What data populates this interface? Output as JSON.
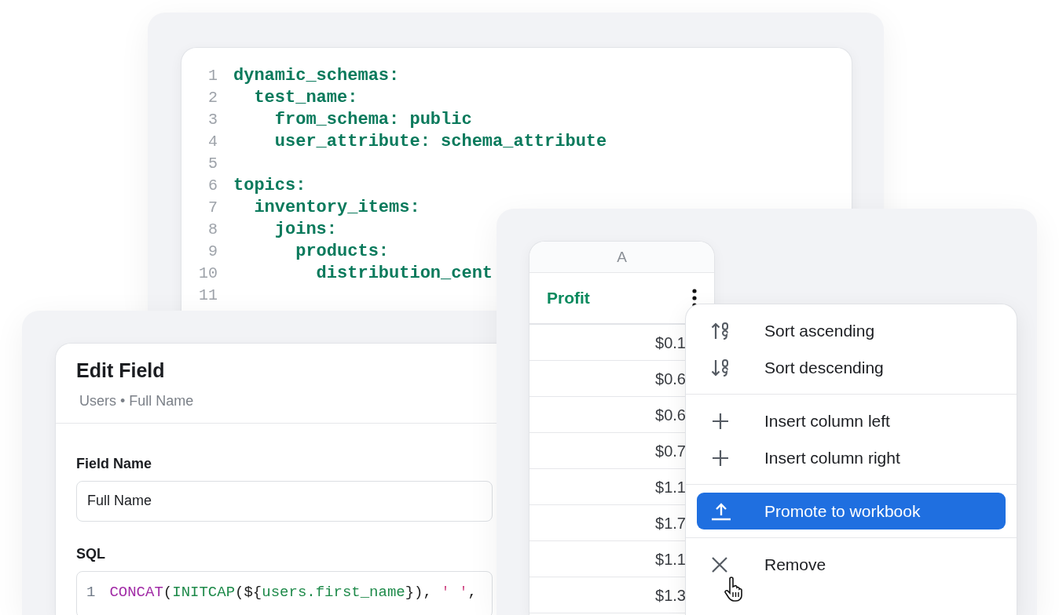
{
  "yaml_editor": {
    "lines": [
      {
        "number": "1",
        "text": "dynamic_schemas:"
      },
      {
        "number": "2",
        "text": "  test_name:"
      },
      {
        "number": "3",
        "text": "    from_schema: public"
      },
      {
        "number": "4",
        "text": "    user_attribute: schema_attribute"
      },
      {
        "number": "5"
      },
      {
        "number": "6",
        "text": "topics:"
      },
      {
        "number": "7",
        "text": "  inventory_items:"
      },
      {
        "number": "8",
        "text": "    joins:"
      },
      {
        "number": "9",
        "text": "      products:"
      },
      {
        "number": "10",
        "text": "        distribution_cent"
      },
      {
        "number": "11"
      }
    ]
  },
  "edit_field": {
    "title": "Edit Field",
    "breadcrumb": "Users • Full Name",
    "field_name_label": "Field Name",
    "field_name_value": "Full Name",
    "sql_label": "SQL",
    "sql_lines": [
      {
        "number": "1",
        "tokens": [
          {
            "kind": "function",
            "text": "CONCAT"
          },
          {
            "kind": "punct",
            "text": "("
          },
          {
            "kind": "call",
            "text": "INITCAP"
          },
          {
            "kind": "punct",
            "text": "(${"
          },
          {
            "kind": "ref",
            "text": "users.first_name"
          },
          {
            "kind": "punct",
            "text": "}),"
          },
          {
            "kind": "string",
            "text": " ' '"
          },
          {
            "kind": "punct",
            "text": ","
          }
        ]
      }
    ]
  },
  "table": {
    "column_letter": "A",
    "header": "Profit",
    "rows": [
      "$0.1",
      "$0.6",
      "$0.6",
      "$0.7",
      "$1.1",
      "$1.7",
      "$1.1",
      "$1.3"
    ]
  },
  "column_menu": {
    "groups": [
      [
        {
          "kind": "sort_ascending",
          "label": "Sort ascending",
          "selected": false
        },
        {
          "kind": "sort_descending",
          "label": "Sort descending",
          "selected": false
        }
      ],
      [
        {
          "kind": "insert",
          "label": "Insert column left",
          "selected": false
        },
        {
          "kind": "insert",
          "label": "Insert column right",
          "selected": false
        }
      ],
      [
        {
          "kind": "promote",
          "label": "Promote to workbook",
          "selected": true
        }
      ],
      [
        {
          "kind": "remove",
          "label": "Remove",
          "selected": false
        }
      ]
    ]
  }
}
